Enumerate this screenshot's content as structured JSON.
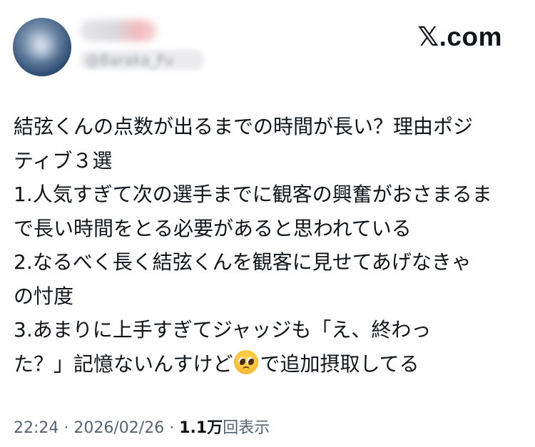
{
  "header": {
    "display_name": "",
    "handle": "@Baraka_Fu",
    "site_logo": "𝕏.com"
  },
  "post": {
    "lines": [
      "結弦くんの点数が出るまでの時間が長い？理由ポジ",
      "ティブ３選",
      "1.人気すぎて次の選手までに観客の興奮がおさまるま",
      "で長い時間をとる必要があると思われている",
      "2.なるべく長く結弦くんを観客に見せてあげなきゃ",
      "の忖度",
      "3.あまりに上手すぎてジャッジも「え、終わっ"
    ],
    "last_line_before_emoji": "た？」記憶ないんすけど",
    "emoji": "pleading-face-emoji",
    "last_line_after_emoji": "で追加摂取してる"
  },
  "meta": {
    "time": "22:24",
    "separator": "·",
    "date": "2026/02/26",
    "views_count": "1.1万",
    "views_label": "回表示"
  }
}
